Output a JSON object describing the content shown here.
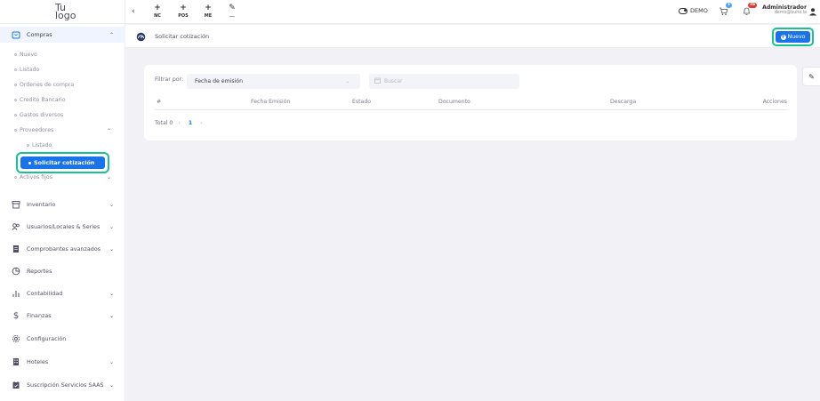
{
  "logo": {
    "line1": "Tu",
    "line2": "logo"
  },
  "sidebar": {
    "compras": {
      "label": "Compras"
    },
    "compras_items": [
      "Nuevo",
      "Listado",
      "Ordenes de compra",
      "Credito Bancario",
      "Gastos diversos",
      "Proveedores"
    ],
    "proveedores_items": [
      "Listado"
    ],
    "selected": "Solicitar cotización",
    "activos": "Activos fijos",
    "modules": [
      {
        "label": "Inventario"
      },
      {
        "label": "Usuarios/Locales & Series"
      },
      {
        "label": "Comprobantes avanzados"
      },
      {
        "label": "Reportes"
      },
      {
        "label": "Contabilidad"
      },
      {
        "label": "Finanzas"
      },
      {
        "label": "Configuración"
      },
      {
        "label": "Hoteles"
      },
      {
        "label": "Suscripción Servicios SAAS"
      }
    ]
  },
  "topbar": {
    "quick": [
      {
        "icon": "+",
        "label": "NC"
      },
      {
        "icon": "+",
        "label": "POS"
      },
      {
        "icon": "+",
        "label": "ME"
      },
      {
        "icon": "✎",
        "label": "..."
      }
    ],
    "demo_label": "DEMO",
    "cart_count": "1",
    "bell_count": "26",
    "user_name": "Administrador",
    "user_email": "demo@buho.la"
  },
  "page": {
    "title": "Solicitar cotización",
    "new_button": "Nuevo"
  },
  "filter": {
    "label": "Filtrar por:",
    "selected": "Fecha de emisión",
    "search_placeholder": "Buscar"
  },
  "table": {
    "columns": [
      "#",
      "Fecha Emisión",
      "Estado",
      "Documento",
      "Descarga",
      "Acciones"
    ]
  },
  "pagination": {
    "total_label": "Total 0",
    "current_page": "1"
  },
  "colors": {
    "primary": "#1a73e8",
    "highlight": "#14c38e",
    "bell_badge": "#e53935",
    "cart_badge": "#4aa3ff"
  }
}
